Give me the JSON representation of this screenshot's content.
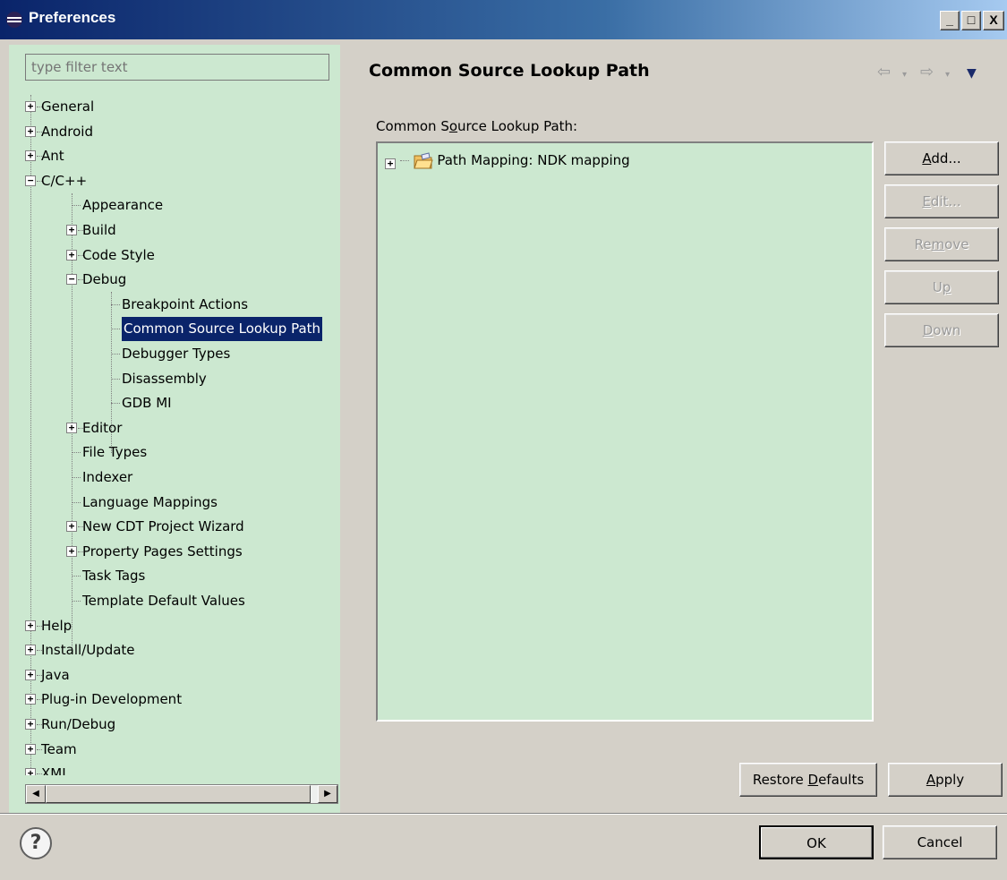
{
  "window": {
    "title": "Preferences",
    "controls": [
      "_",
      "□",
      "X"
    ]
  },
  "filter": {
    "placeholder": "type filter text"
  },
  "tree": [
    {
      "label": "General",
      "level": 0,
      "expander": "+"
    },
    {
      "label": "Android",
      "level": 0,
      "expander": "+"
    },
    {
      "label": "Ant",
      "level": 0,
      "expander": "+"
    },
    {
      "label": "C/C++",
      "level": 0,
      "expander": "-"
    },
    {
      "label": "Appearance",
      "level": 1,
      "expander": ""
    },
    {
      "label": "Build",
      "level": 1,
      "expander": "+"
    },
    {
      "label": "Code Style",
      "level": 1,
      "expander": "+"
    },
    {
      "label": "Debug",
      "level": 1,
      "expander": "-"
    },
    {
      "label": "Breakpoint Actions",
      "level": 2,
      "expander": ""
    },
    {
      "label": "Common Source Lookup Path",
      "level": 2,
      "expander": "",
      "selected": true
    },
    {
      "label": "Debugger Types",
      "level": 2,
      "expander": ""
    },
    {
      "label": "Disassembly",
      "level": 2,
      "expander": ""
    },
    {
      "label": "GDB MI",
      "level": 2,
      "expander": ""
    },
    {
      "label": "Editor",
      "level": 1,
      "expander": "+"
    },
    {
      "label": "File Types",
      "level": 1,
      "expander": ""
    },
    {
      "label": "Indexer",
      "level": 1,
      "expander": ""
    },
    {
      "label": "Language Mappings",
      "level": 1,
      "expander": ""
    },
    {
      "label": "New CDT Project Wizard",
      "level": 1,
      "expander": "+"
    },
    {
      "label": "Property Pages Settings",
      "level": 1,
      "expander": "+"
    },
    {
      "label": "Task Tags",
      "level": 1,
      "expander": ""
    },
    {
      "label": "Template Default Values",
      "level": 1,
      "expander": ""
    },
    {
      "label": "Help",
      "level": 0,
      "expander": "+"
    },
    {
      "label": "Install/Update",
      "level": 0,
      "expander": "+"
    },
    {
      "label": "Java",
      "level": 0,
      "expander": "+"
    },
    {
      "label": "Plug-in Development",
      "level": 0,
      "expander": "+"
    },
    {
      "label": "Run/Debug",
      "level": 0,
      "expander": "+"
    },
    {
      "label": "Team",
      "level": 0,
      "expander": "+"
    },
    {
      "label": "XML",
      "level": 0,
      "expander": "+"
    }
  ],
  "page": {
    "title": "Common Source Lookup Path",
    "section_label_pre": "Common S",
    "section_label_ul": "o",
    "section_label_post": "urce Lookup Path:",
    "list_items": [
      {
        "label": "Path Mapping: NDK mapping",
        "icon": "folder-path-icon"
      }
    ],
    "side_buttons": {
      "add": {
        "ul": "A",
        "rest": "dd..."
      },
      "edit": {
        "ul": "E",
        "rest": "dit..."
      },
      "remove": {
        "pre": "Re",
        "ul": "m",
        "rest": "ove"
      },
      "up": {
        "pre": "U",
        "ul": "p",
        "rest": ""
      },
      "down": {
        "ul": "D",
        "rest": "own"
      }
    },
    "restore_defaults": {
      "pre": "Restore ",
      "ul": "D",
      "rest": "efaults"
    },
    "apply": {
      "ul": "A",
      "rest": "pply"
    }
  },
  "footer": {
    "help": "?",
    "ok": "OK",
    "cancel": "Cancel"
  }
}
